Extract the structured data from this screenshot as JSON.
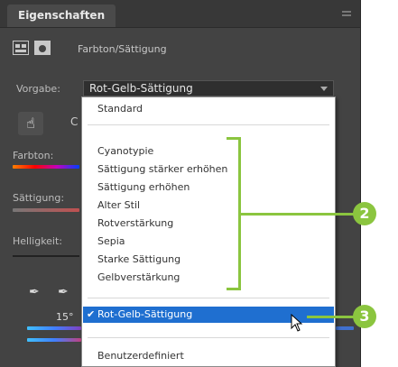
{
  "panel": {
    "tab_label": "Eigenschaften",
    "adjustment_title": "Farbton/Sättigung"
  },
  "preset": {
    "label": "Vorgabe:",
    "value": "Rot-Gelb-Sättigung"
  },
  "fields": {
    "hue": "Farbton:",
    "saturation": "Sättigung:",
    "lightness": "Helligkeit:",
    "angle": "15°"
  },
  "dropdown": {
    "items": [
      "Standard",
      "Cyanotypie",
      "Sättigung stärker erhöhen",
      "Sättigung erhöhen",
      "Alter Stil",
      "Rotverstärkung",
      "Sepia",
      "Starke Sättigung",
      "Gelbverstärkung",
      "Rot-Gelb-Sättigung",
      "Benutzerdefiniert"
    ],
    "selected": "Rot-Gelb-Sättigung"
  },
  "callouts": {
    "two": "2",
    "three": "3"
  },
  "colors": {
    "accent_green": "#8bc53f",
    "selection_blue": "#1f6fd0",
    "panel_bg": "#434343"
  }
}
